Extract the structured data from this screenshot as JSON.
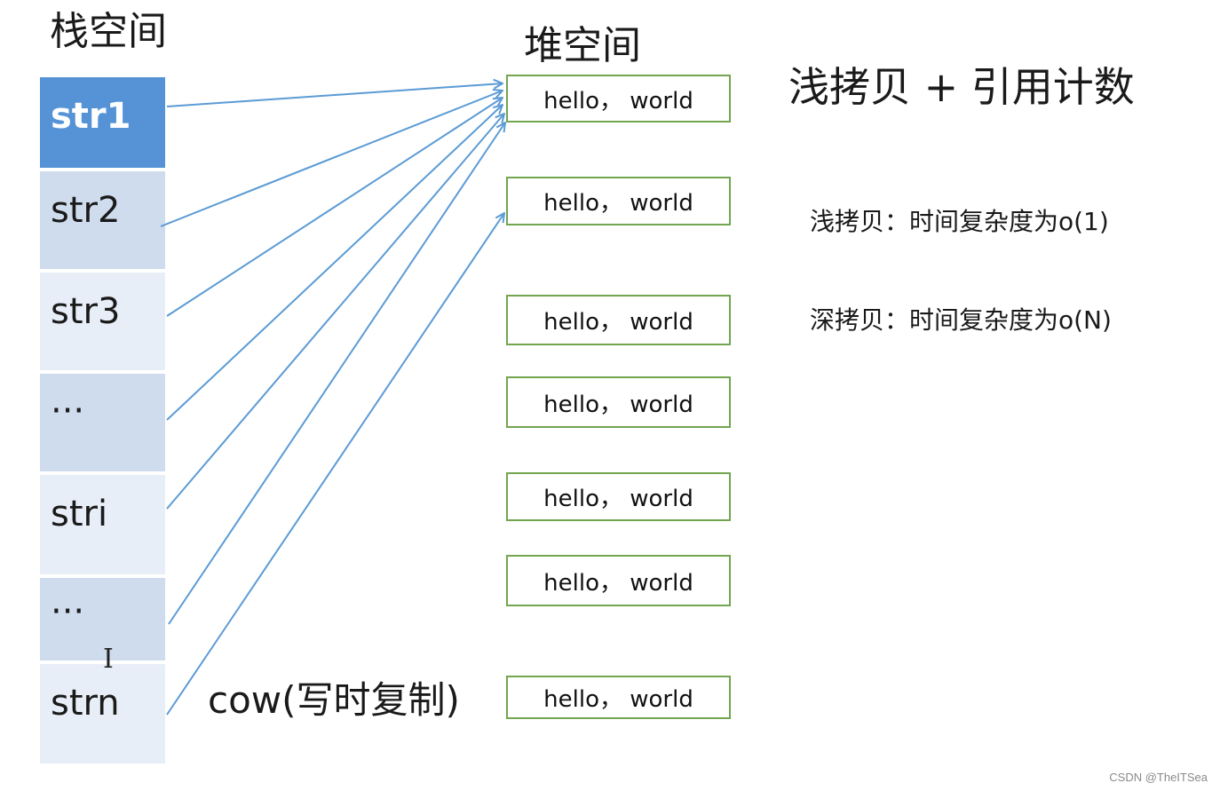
{
  "stack": {
    "title": "栈空间",
    "cells": [
      {
        "label": "str1",
        "style": "active"
      },
      {
        "label": "str2",
        "style": "dark"
      },
      {
        "label": "str3",
        "style": "light"
      },
      {
        "label": "···",
        "style": "dark"
      },
      {
        "label": "stri",
        "style": "light"
      },
      {
        "label": "···",
        "style": "dark"
      },
      {
        "label": "strn",
        "style": "light"
      }
    ]
  },
  "heap": {
    "title": "堆空间",
    "boxes": [
      {
        "label": "hello， world"
      },
      {
        "label": "hello， world"
      },
      {
        "label": "hello， world"
      },
      {
        "label": "hello， world"
      },
      {
        "label": "hello， world"
      },
      {
        "label": "hello， world"
      },
      {
        "label": "hello， world"
      }
    ]
  },
  "arrows": [
    {
      "from": "str1",
      "to": 0
    },
    {
      "from": "str2",
      "to": 0
    },
    {
      "from": "str3",
      "to": 0
    },
    {
      "from": "···",
      "to": 0
    },
    {
      "from": "stri",
      "to": 0
    },
    {
      "from": "···",
      "to": 0
    },
    {
      "from": "strn",
      "to": 1
    }
  ],
  "notes": {
    "main": "浅拷贝 + 引用计数",
    "shallow": "浅拷贝：时间复杂度为o(1)",
    "deep": "深拷贝：时间复杂度为o(N)",
    "cow": "cow(写时复制)"
  },
  "colors": {
    "arrow": "#5b9bd5",
    "box_border": "#72a54f",
    "active_cell": "#5593d6"
  },
  "watermark": "CSDN @TheITSea",
  "cursor_icon": "text-cursor-icon"
}
